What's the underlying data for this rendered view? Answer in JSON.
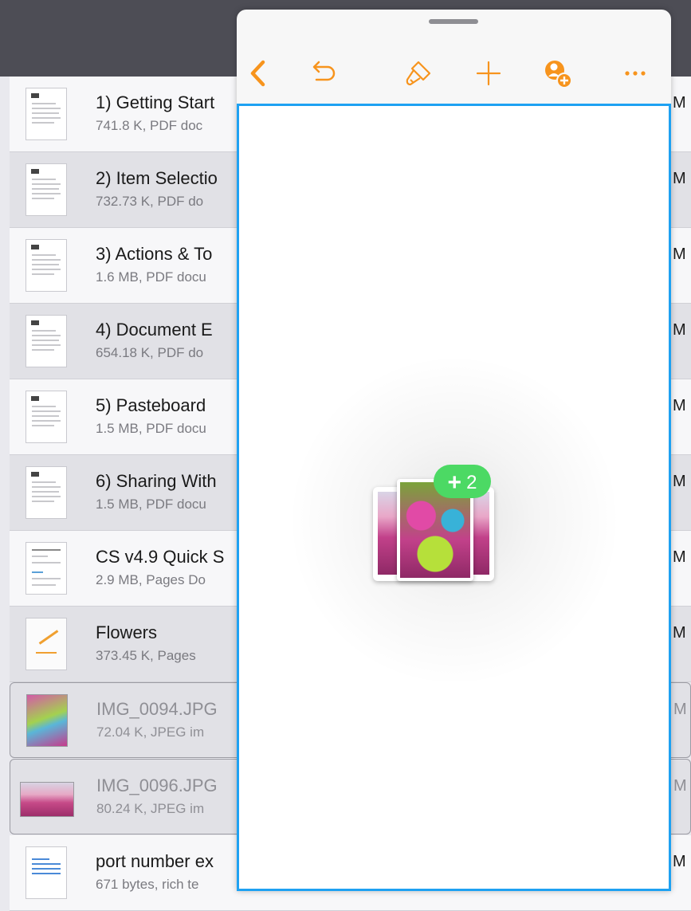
{
  "files": [
    {
      "title": "1) Getting Start",
      "subtitle": "741.8 K, PDF doc",
      "kind": "pdf",
      "edge": "M"
    },
    {
      "title": "2) Item Selectio",
      "subtitle": "732.73 K, PDF do",
      "kind": "pdf",
      "edge": "M"
    },
    {
      "title": "3) Actions & To",
      "subtitle": "1.6 MB, PDF docu",
      "kind": "pdf",
      "edge": "M"
    },
    {
      "title": "4) Document E",
      "subtitle": "654.18 K, PDF do",
      "kind": "pdf",
      "edge": "M"
    },
    {
      "title": "5) Pasteboard",
      "subtitle": "1.5 MB, PDF docu",
      "kind": "pdf",
      "edge": "M"
    },
    {
      "title": "6) Sharing With",
      "subtitle": "1.5 MB, PDF docu",
      "kind": "pdf",
      "edge": "M"
    },
    {
      "title": "CS v4.9 Quick S",
      "subtitle": "2.9 MB, Pages Do",
      "kind": "pdf",
      "edge": "M"
    },
    {
      "title": "Flowers",
      "subtitle": "373.45 K, Pages",
      "kind": "pages",
      "edge": "M"
    },
    {
      "title": "IMG_0094.JPG",
      "subtitle": "72.04 K, JPEG im",
      "kind": "image",
      "edge": "M"
    },
    {
      "title": "IMG_0096.JPG",
      "subtitle": "80.24 K, JPEG im",
      "kind": "image-wide",
      "edge": "M"
    },
    {
      "title": "port number ex",
      "subtitle": "671 bytes, rich te",
      "kind": "rtf",
      "edge": "M"
    }
  ],
  "toolbar": {
    "icons": [
      "back-icon",
      "undo-icon",
      "paintbrush-icon",
      "add-icon",
      "add-collaborator-icon",
      "more-icon"
    ],
    "accent_color": "#f7941d"
  },
  "drag": {
    "badge_symbol": "+",
    "badge_count": "2",
    "badge_color": "#4cd964"
  },
  "drop_target_border_color": "#1ea1f2"
}
